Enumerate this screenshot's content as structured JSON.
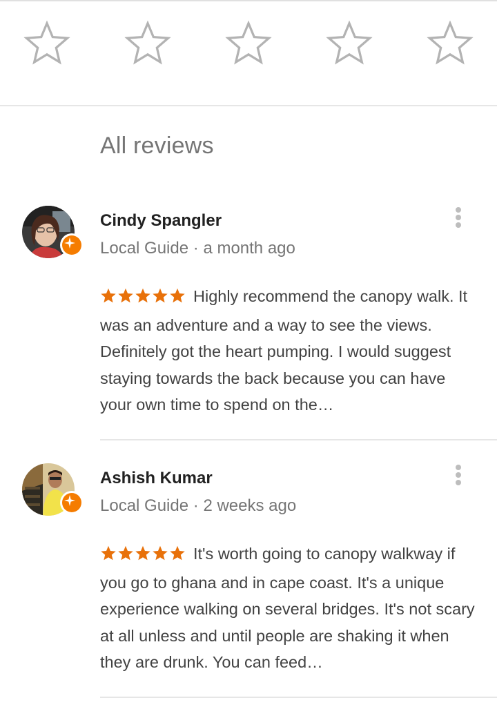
{
  "rating_prompt": {
    "stars": [
      {
        "icon": "star-outline-icon",
        "value": 1
      },
      {
        "icon": "star-outline-icon",
        "value": 2
      },
      {
        "icon": "star-outline-icon",
        "value": 3
      },
      {
        "icon": "star-outline-icon",
        "value": 4
      },
      {
        "icon": "star-outline-icon",
        "value": 5
      }
    ]
  },
  "section_title": "All reviews",
  "reviews": [
    {
      "name": "Cindy Spangler",
      "badge": "Local Guide",
      "separator": "·",
      "time": "a month ago",
      "rating": 5,
      "text": "Highly recommend the canopy walk. It was an adventure and a way to see the views.  Definitely got the heart pumping. I would suggest staying towards the back because you can have your own time to spend on the…"
    },
    {
      "name": "Ashish Kumar",
      "badge": "Local Guide",
      "separator": "·",
      "time": "2 weeks ago",
      "rating": 5,
      "text": "It's worth going to canopy walkway if you go to ghana and in cape coast. It's a unique experience walking on several bridges. It's not scary at all unless and until people are shaking it when they are drunk. You can feed…"
    }
  ],
  "colors": {
    "star_filled": "#e8710a",
    "star_outline": "#b3b3b3",
    "guide_badge": "#f57c00",
    "text_primary": "#212121",
    "text_secondary": "#757575"
  }
}
